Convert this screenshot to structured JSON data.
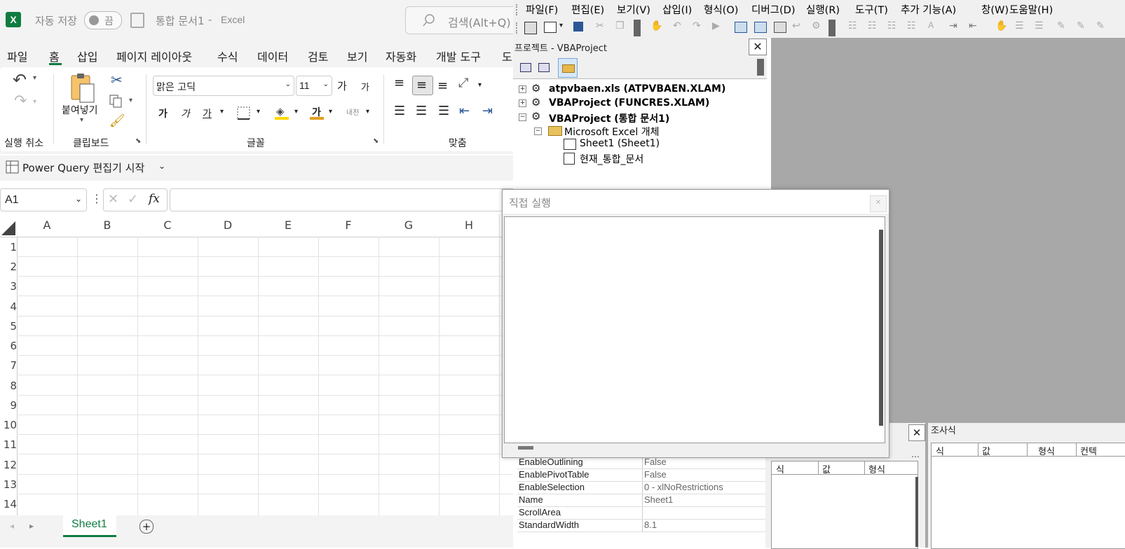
{
  "excel": {
    "autosave_label": "자동 저장",
    "autosave_state": "끔",
    "doc_title": "통합 문서1",
    "title_sep": "-",
    "app_name": "Excel",
    "search_placeholder": "검색(Alt+Q)",
    "tabs": [
      "파일",
      "홈",
      "삽입",
      "페이지 레이아웃",
      "수식",
      "데이터",
      "검토",
      "보기",
      "자동화",
      "개발 도구",
      "도"
    ],
    "ribbon": {
      "undo_group": "실행 취소",
      "paste_label": "붙여넣기",
      "clipboard_group": "클립보드",
      "font_name": "맑은 고딕",
      "font_size": "11",
      "font_group": "글꼴",
      "align_group": "맞춤",
      "increase_font": "가",
      "decrease_font": "가",
      "bold": "가",
      "italic": "가",
      "underline": "가",
      "font_color_glyph": "가",
      "phonetic": "내천"
    },
    "power_query": "Power Query 편집기 시작",
    "name_box": "A1",
    "columns": [
      "A",
      "B",
      "C",
      "D",
      "E",
      "F",
      "G",
      "H"
    ],
    "rows": [
      "1",
      "2",
      "3",
      "4",
      "5",
      "6",
      "7",
      "8",
      "9",
      "10",
      "11",
      "12",
      "13",
      "14"
    ],
    "sheet_tab": "Sheet1"
  },
  "vbe": {
    "menu": [
      "파일(F)",
      "편집(E)",
      "보기(V)",
      "삽입(I)",
      "형식(O)",
      "디버그(D)",
      "실행(R)",
      "도구(T)",
      "추가 기능(A)",
      "창(W)",
      "도움말(H)"
    ],
    "project_title": "프로젝트 - VBAProject",
    "tree": {
      "atp": "atpvbaen.xls (ATPVBAEN.XLAM)",
      "funcres": "VBAProject (FUNCRES.XLAM)",
      "vbaproject": "VBAProject (통합 문서1)",
      "excel_objects": "Microsoft Excel 개체",
      "sheet1": "Sheet1 (Sheet1)",
      "thisworkbook": "현재_통합_문서"
    },
    "immediate_title": "직접 실행",
    "properties": [
      {
        "name": "EnableOutlining",
        "value": "False"
      },
      {
        "name": "EnablePivotTable",
        "value": "False"
      },
      {
        "name": "EnableSelection",
        "value": "0 - xlNoRestrictions"
      },
      {
        "name": "Name",
        "value": "Sheet1"
      },
      {
        "name": "ScrollArea",
        "value": ""
      },
      {
        "name": "StandardWidth",
        "value": "8.1"
      }
    ],
    "locals_headers": [
      "식",
      "값",
      "형식"
    ],
    "watch_title": "조사식",
    "watch_headers": [
      "식",
      "값",
      "형식",
      "컨텍"
    ]
  }
}
